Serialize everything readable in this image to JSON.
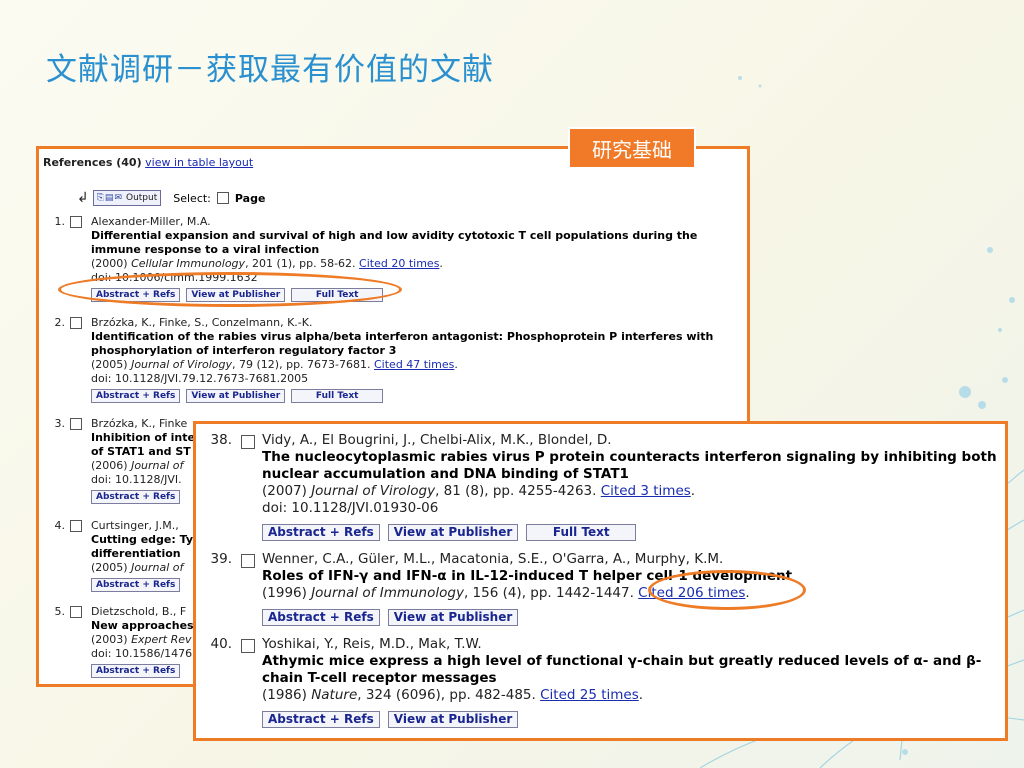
{
  "slide": {
    "title": "文献调研－获取最有价值的文献",
    "tag": "研究基础"
  },
  "colors": {
    "accent": "#ee7b26",
    "title": "#2a90cf",
    "link": "#1a2cb0"
  },
  "panel1": {
    "header": {
      "label": "References (40)",
      "link": "view in table layout"
    },
    "toolbar": {
      "output_icons": "folder-print-email-icons",
      "output_label": "Output",
      "select_label": "Select:",
      "page_label": "Page"
    },
    "refs": [
      {
        "num": "1.",
        "authors": "Alexander-Miller, M.A.",
        "title": "Differential expansion and survival of high and low avidity cytotoxic T cell populations during the immune response to a viral infection",
        "year": "(2000)",
        "journal": "Cellular Immunology",
        "details": ", 201 (1), pp. 58-62. ",
        "cited": "Cited 20 times",
        "doi": "doi: 10.1006/cimm.1999.1632",
        "buttons": [
          "Abstract + Refs",
          "View at Publisher",
          "Full Text"
        ]
      },
      {
        "num": "2.",
        "authors": "Brzózka, K., Finke, S., Conzelmann, K.-K.",
        "title": "Identification of the rabies virus alpha/beta interferon antagonist: Phosphoprotein P interferes with phosphorylation of interferon regulatory factor 3",
        "year": "(2005)",
        "journal": "Journal of Virology",
        "details": ", 79 (12), pp. 7673-7681. ",
        "cited": "Cited 47 times",
        "doi": "doi: 10.1128/JVI.79.12.7673-7681.2005",
        "buttons": [
          "Abstract + Refs",
          "View at Publisher",
          "Full Text"
        ]
      },
      {
        "num": "3.",
        "authors": "Brzózka, K., Finke",
        "title": "Inhibition of inte",
        "title2": "of STAT1 and ST",
        "year": "(2006)",
        "journal": "Journal of",
        "doi": "doi: 10.1128/JVI.",
        "buttons": [
          "Abstract + Refs"
        ]
      },
      {
        "num": "4.",
        "authors": "Curtsinger, J.M.,",
        "title": "Cutting edge: Ty",
        "title2": "differentiation",
        "year": "(2005)",
        "journal": "Journal of",
        "buttons": [
          "Abstract + Refs"
        ]
      },
      {
        "num": "5.",
        "authors": "Dietzschold, B., F",
        "title": "New approaches",
        "year": "(2003)",
        "journal": "Expert Rev",
        "doi": "doi: 10.1586/1476",
        "buttons": [
          "Abstract + Refs"
        ]
      }
    ]
  },
  "panel2": {
    "refs": [
      {
        "num": "38.",
        "authors": "Vidy, A., El Bougrini, J., Chelbi-Alix, M.K., Blondel, D.",
        "title": "The nucleocytoplasmic rabies virus P protein counteracts interferon signaling by inhibiting both nuclear accumulation and DNA binding of STAT1",
        "year": "(2007)",
        "journal": "Journal of Virology",
        "details": ", 81 (8), pp. 4255-4263. ",
        "cited": "Cited 3 times",
        "doi": "doi: 10.1128/JVI.01930-06",
        "buttons": [
          "Abstract + Refs",
          "View at Publisher",
          "Full Text"
        ]
      },
      {
        "num": "39.",
        "authors": "Wenner, C.A., Güler, M.L., Macatonia, S.E., O'Garra, A., Murphy, K.M.",
        "title": "Roles of IFN-γ and IFN-α in IL-12-induced T helper cell-1 development",
        "year": "(1996)",
        "journal": "Journal of Immunology",
        "details": ", 156 (4), pp. 1442-1447. ",
        "cited": "Cited 206 times",
        "buttons": [
          "Abstract + Refs",
          "View at Publisher"
        ]
      },
      {
        "num": "40.",
        "authors": "Yoshikai, Y., Reis, M.D., Mak, T.W.",
        "title": "Athymic mice express a high level of functional γ-chain but greatly reduced levels of α- and β-chain T-cell receptor messages",
        "year": "(1986)",
        "journal": "Nature",
        "details": ", 324 (6096), pp. 482-485. ",
        "cited": "Cited 25 times",
        "buttons": [
          "Abstract + Refs",
          "View at Publisher"
        ]
      }
    ]
  }
}
